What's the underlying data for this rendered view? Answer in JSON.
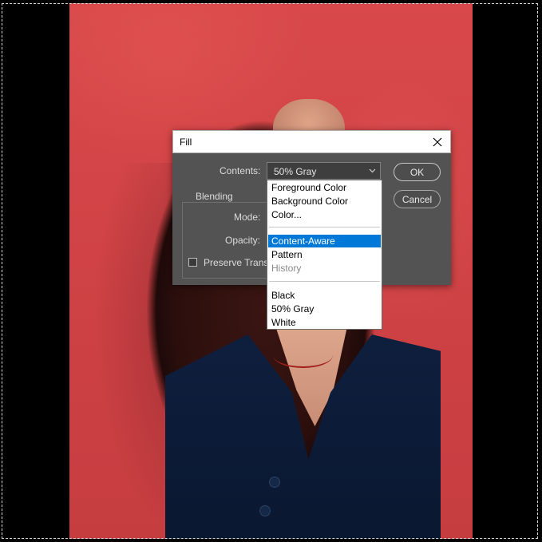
{
  "dialog": {
    "title": "Fill",
    "contents_label": "Contents:",
    "contents_value": "50% Gray",
    "ok_label": "OK",
    "cancel_label": "Cancel",
    "blending_legend": "Blending",
    "mode_label": "Mode:",
    "opacity_label": "Opacity:",
    "preserve_label": "Preserve Trans"
  },
  "dropdown": {
    "group1": [
      "Foreground Color",
      "Background Color",
      "Color..."
    ],
    "group2": [
      "Content-Aware",
      "Pattern",
      "History"
    ],
    "group3": [
      "Black",
      "50% Gray",
      "White"
    ],
    "selected": "Content-Aware",
    "disabled": "History"
  },
  "icons": {
    "close": "close-icon",
    "select_arrow": "chevron-down-icon"
  },
  "colors": {
    "highlight": "#0078d7",
    "dialog_bg": "#535353"
  }
}
